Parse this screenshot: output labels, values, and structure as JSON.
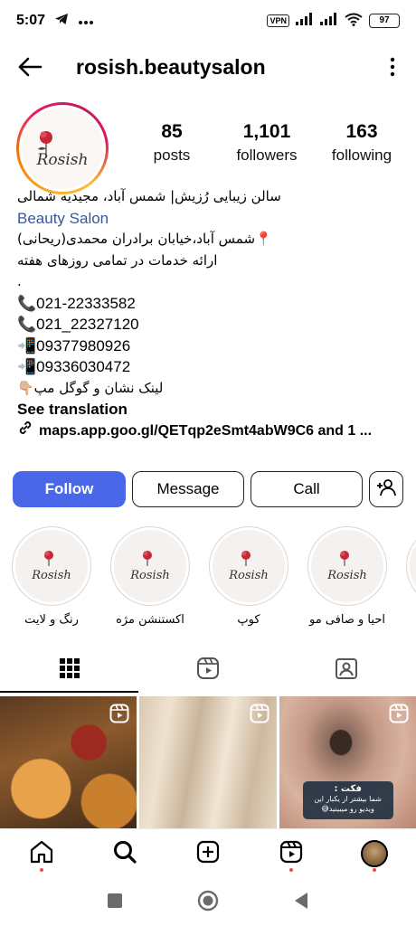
{
  "status_bar": {
    "time": "5:07",
    "vpn": "VPN",
    "battery": "97"
  },
  "header": {
    "username": "rosish.beautysalon"
  },
  "profile": {
    "logo_text": "Rosish",
    "stats": [
      {
        "value": "85",
        "label": "posts"
      },
      {
        "value": "1,101",
        "label": "followers"
      },
      {
        "value": "163",
        "label": "following"
      }
    ]
  },
  "bio": {
    "name": "سالن زیبایی رُزیش| شمس آباد، مجیدیه شمالی",
    "category": "Beauty Salon",
    "address": "📍شمس آباد،خیابان برادران محمدی(ریحانی)",
    "services": "ارائه خدمات در تمامی روزهای هفته",
    "dot": ".",
    "phones": [
      "📞021-22333582",
      "📞021_22327120",
      "📲09377980926",
      "📲09336030472"
    ],
    "map_note": "لینک نشان و گوگل مپ👇🏼",
    "see_translation": "See translation",
    "link": "maps.app.goo.gl/QETqp2eSmt4abW9C6 and 1 ..."
  },
  "actions": {
    "follow": "Follow",
    "message": "Message",
    "call": "Call"
  },
  "highlights": [
    {
      "label": "رنگ و لایت",
      "logo": "Rosish"
    },
    {
      "label": "اکستنشن مژه",
      "logo": "Rosish"
    },
    {
      "label": "کوپ",
      "logo": "Rosish"
    },
    {
      "label": "احیا و صافی مو",
      "logo": "Rosish"
    }
  ],
  "grid": {
    "fact_title": "فکت :",
    "fact_line1": "شما بیشتر از یکبار این",
    "fact_line2": "ویدیو رو میبینید😅"
  },
  "colors": {
    "follow_button": "#4a67ea",
    "category_link": "#385898",
    "notification_dot": "#ed4956"
  }
}
